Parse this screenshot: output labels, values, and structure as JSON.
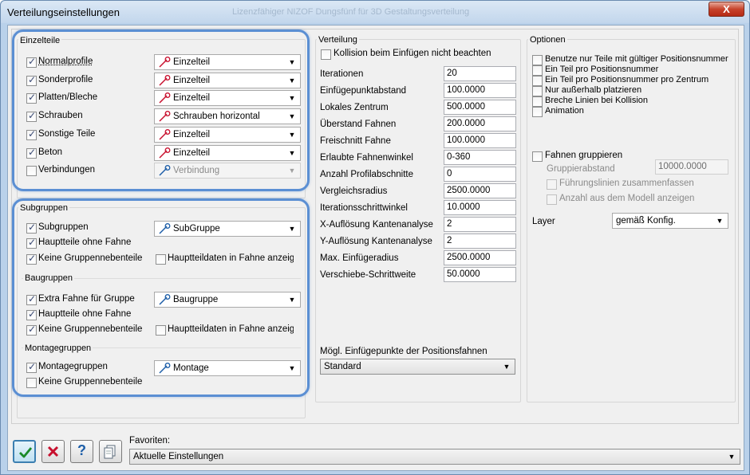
{
  "window": {
    "title": "Verteilungseinstellungen",
    "ghost_title": "Lizenzfähiger NIZOF Dungsfünf für 3D Gestaltungsverteilung",
    "close_label": "X"
  },
  "einzelteile": {
    "label": "Einzelteile",
    "rows": [
      {
        "label": "Normalprofile",
        "checked": true,
        "combo": "Einzelteil",
        "icon": "single-part-icon"
      },
      {
        "label": "Sonderprofile",
        "checked": true,
        "combo": "Einzelteil",
        "icon": "single-part-icon"
      },
      {
        "label": "Platten/Bleche",
        "checked": true,
        "combo": "Einzelteil",
        "icon": "single-part-icon"
      },
      {
        "label": "Schrauben",
        "checked": true,
        "combo": "Schrauben horizontal",
        "icon": "single-part-icon"
      },
      {
        "label": "Sonstige Teile",
        "checked": true,
        "combo": "Einzelteil",
        "icon": "single-part-icon"
      },
      {
        "label": "Beton",
        "checked": true,
        "combo": "Einzelteil",
        "icon": "single-part-icon"
      },
      {
        "label": "Verbindungen",
        "checked": false,
        "combo": "Verbindung",
        "icon": "connection-icon"
      }
    ]
  },
  "subgruppen": {
    "label": "Subgruppen",
    "main_label": "Subgruppen",
    "combo": "SubGruppe",
    "haupt_label": "Hauptteile ohne Fahne",
    "neben_label": "Keine Gruppennebenteile",
    "daten_label": "Hauptteildaten in Fahne anzeigen"
  },
  "baugruppen": {
    "label": "Baugruppen",
    "main_label": "Extra Fahne für Gruppe",
    "combo": "Baugruppe",
    "haupt_label": "Hauptteile ohne Fahne",
    "neben_label": "Keine Gruppennebenteile",
    "daten_label": "Hauptteildaten in Fahne anzeigen"
  },
  "montagegruppen": {
    "label": "Montagegruppen",
    "main_label": "Montagegruppen",
    "combo": "Montage",
    "neben_label": "Keine Gruppennebenteile"
  },
  "verteilung": {
    "label": "Verteilung",
    "kollision_label": "Kollision beim Einfügen nicht beachten",
    "fields": [
      {
        "label": "Iterationen",
        "value": "20"
      },
      {
        "label": "Einfügepunktabstand",
        "value": "100.0000"
      },
      {
        "label": "Lokales Zentrum",
        "value": "500.0000"
      },
      {
        "label": "Überstand Fahnen",
        "value": "200.0000"
      },
      {
        "label": "Freischnitt Fahne",
        "value": "100.0000"
      },
      {
        "label": "Erlaubte Fahnenwinkel",
        "value": "0-360"
      },
      {
        "label": "Anzahl Profilabschnitte",
        "value": "0"
      },
      {
        "label": "Vergleichsradius",
        "value": "2500.0000"
      },
      {
        "label": "Iterationsschrittwinkel",
        "value": "10.0000"
      },
      {
        "label": "X-Auflösung Kantenanalyse",
        "value": "2"
      },
      {
        "label": "Y-Auflösung Kantenanalyse",
        "value": "2"
      },
      {
        "label": "Max. Einfügeradius",
        "value": "2500.0000"
      },
      {
        "label": "Verschiebe-Schrittweite",
        "value": "50.0000"
      }
    ],
    "einfuege_label": "Mögl. Einfügepunkte der Positionsfahnen",
    "einfuege_value": "Standard"
  },
  "optionen": {
    "label": "Optionen",
    "items": [
      "Benutze nur Teile mit gültiger Positionsnummer",
      "Ein Teil pro Positionsnummer",
      "Ein Teil pro Positionsnummer pro Zentrum",
      "Nur außerhalb platzieren",
      "Breche Linien bei Kollision",
      "Animation"
    ],
    "fahnen_label": "Fahnen gruppieren",
    "gruppierabstand_label": "Gruppierabstand",
    "gruppierabstand_value": "10000.0000",
    "fuehrung_label": "Führungslinien zusammenfassen",
    "anzahl_label": "Anzahl aus dem Modell anzeigen",
    "layer_label": "Layer",
    "layer_value": "gemäß Konfig."
  },
  "footer": {
    "favoriten_label": "Favoriten:",
    "favoriten_value": "Aktuelle Einstellungen",
    "help_label": "?"
  },
  "colors": {
    "highlight": "#5b8fd3",
    "ok_border": "#3c7fb1",
    "cancel_red": "#c8102e",
    "title_bar": "#c2d6ec"
  }
}
